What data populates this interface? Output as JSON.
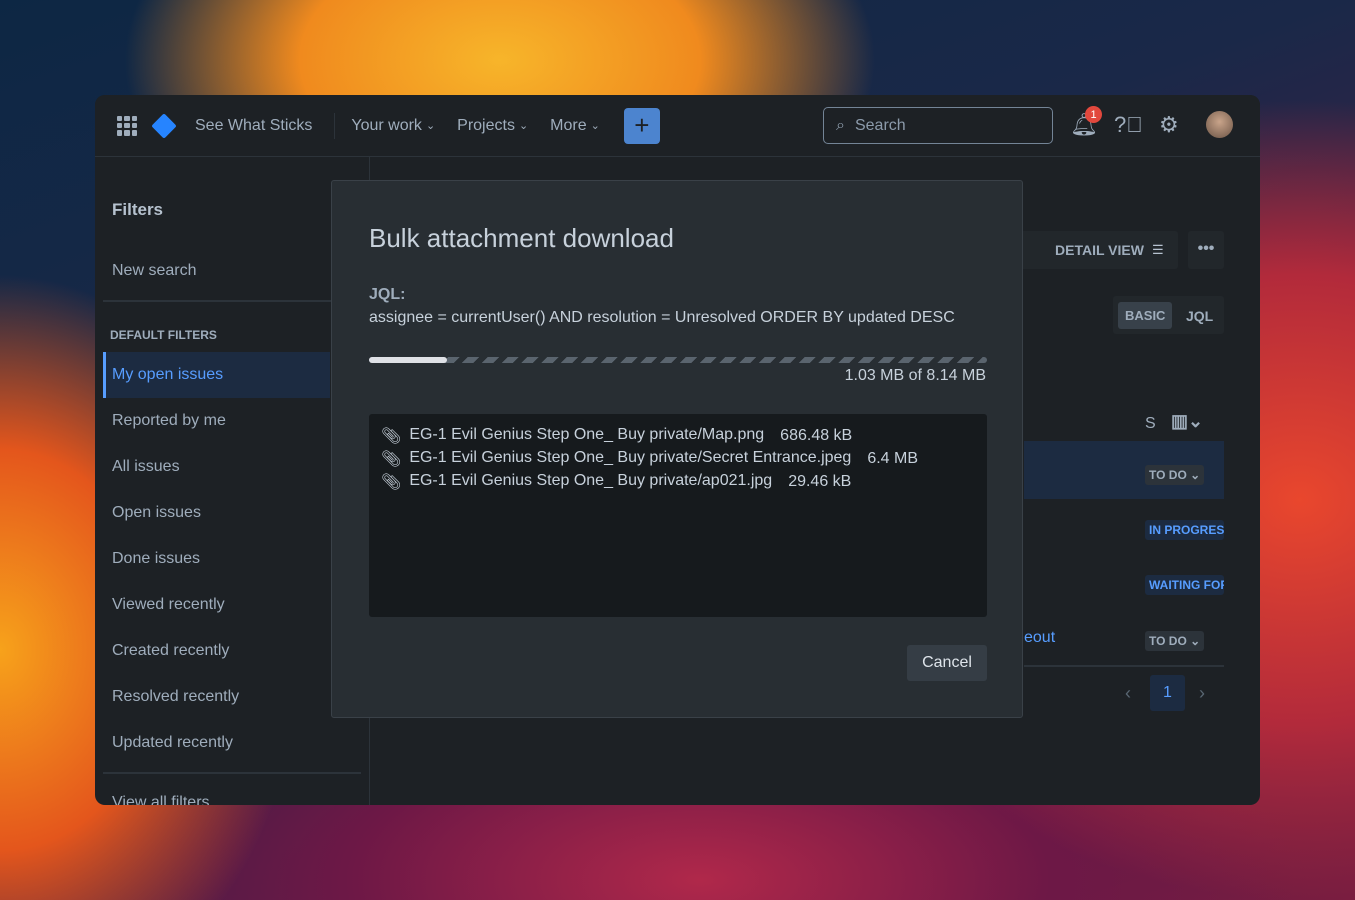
{
  "header": {
    "site": "See What Sticks",
    "nav": [
      "Your work",
      "Projects",
      "More"
    ],
    "search_placeholder": "Search",
    "notifications": "1"
  },
  "sidebar": {
    "title": "Filters",
    "new_search": "New search",
    "section": "DEFAULT FILTERS",
    "items": [
      "My open issues",
      "Reported by me",
      "All issues",
      "Open issues",
      "Done issues",
      "Viewed recently",
      "Created recently",
      "Resolved recently",
      "Updated recently"
    ],
    "view_all": "View all filters"
  },
  "content": {
    "detail_view": "DETAIL VIEW",
    "basic": "BASIC",
    "jql": "JQL",
    "col_s": "S",
    "statuses": [
      "TO DO",
      "IN PROGRESS",
      "WAITING FOR",
      "TO DO"
    ],
    "link_text": "eout",
    "page": "1"
  },
  "modal": {
    "title": "Bulk attachment download",
    "jql_label": "JQL:",
    "jql": "assignee = currentUser() AND resolution = Unresolved ORDER BY updated DESC",
    "progress_fraction": 0.127,
    "progress_text": "1.03 MB of 8.14 MB",
    "files": [
      {
        "name": "EG-1 Evil Genius Step One_ Buy private/Map.png",
        "size": "686.48 kB"
      },
      {
        "name": "EG-1 Evil Genius Step One_ Buy private/Secret Entrance.jpeg",
        "size": "6.4 MB"
      },
      {
        "name": "EG-1 Evil Genius Step One_ Buy private/ap021.jpg",
        "size": "29.46 kB"
      }
    ],
    "cancel": "Cancel"
  }
}
